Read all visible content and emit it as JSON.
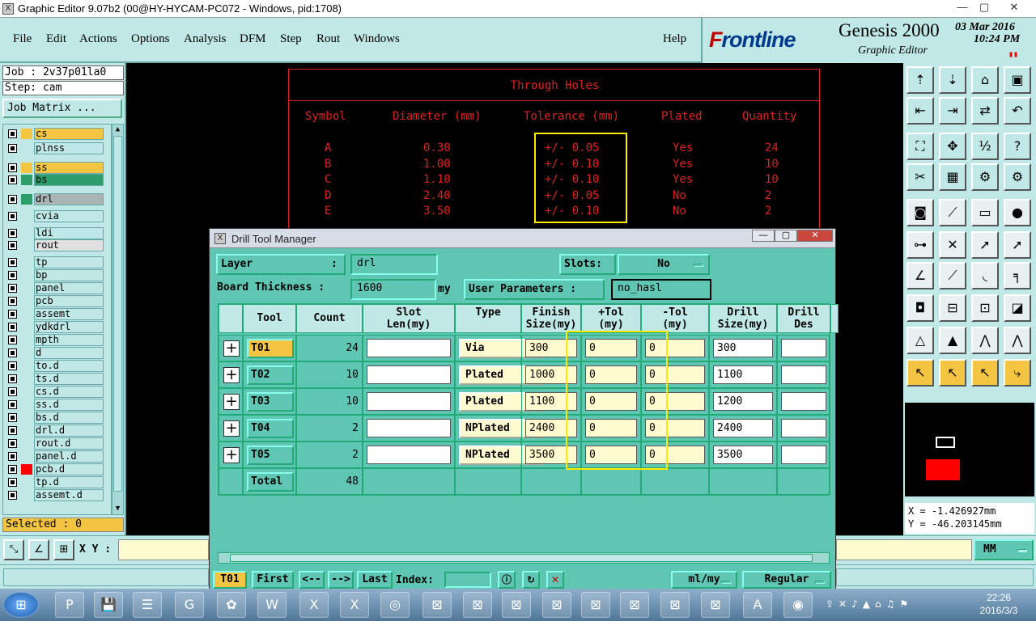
{
  "window": {
    "title": "Graphic Editor 9.07b2 (00@HY-HYCAM-PC072 - Windows, pid:1708)",
    "icon": "X",
    "minimize": "—",
    "maximize": "▢",
    "close": "✕"
  },
  "menu": [
    "File",
    "Edit",
    "Actions",
    "Options",
    "Analysis",
    "DFM",
    "Step",
    "Rout",
    "Windows"
  ],
  "help": "Help",
  "brand": {
    "logo_first": "F",
    "logo_rest": "rontline",
    "product": "Genesis 2000",
    "subtitle": "Graphic Editor",
    "date": "03 Mar 2016",
    "time": "10:24 PM"
  },
  "left": {
    "job": "Job : 2v37p01la0",
    "step": "Step: cam",
    "job_matrix": "Job Matrix ...",
    "selected": "Selected : 0",
    "layers": [
      {
        "name": "cs",
        "color": "#f4c542",
        "bg": "#f4c542"
      },
      {
        "name": "plnss",
        "color": "",
        "bg": ""
      },
      {
        "name": "ss",
        "color": "#f4c542",
        "bg": "#f4c542"
      },
      {
        "name": "bs",
        "color": "#2e9d6b",
        "bg": "#2e9d6b"
      },
      {
        "name": "drl",
        "color": "#2e9d6b",
        "bg": "#a9b4b4"
      },
      {
        "name": "cvia",
        "color": "",
        "bg": ""
      },
      {
        "name": "ldi",
        "color": "",
        "bg": ""
      },
      {
        "name": "rout",
        "color": "",
        "bg": "#e0e0e0"
      },
      {
        "name": "tp",
        "color": "",
        "bg": ""
      },
      {
        "name": "bp",
        "color": "",
        "bg": ""
      },
      {
        "name": "panel",
        "color": "",
        "bg": ""
      },
      {
        "name": "pcb",
        "color": "",
        "bg": ""
      },
      {
        "name": "assemt",
        "color": "",
        "bg": ""
      },
      {
        "name": "ydkdrl",
        "color": "",
        "bg": ""
      },
      {
        "name": "mpth",
        "color": "",
        "bg": ""
      },
      {
        "name": "d",
        "color": "",
        "bg": ""
      },
      {
        "name": "to.d",
        "color": "",
        "bg": ""
      },
      {
        "name": "ts.d",
        "color": "",
        "bg": ""
      },
      {
        "name": "cs.d",
        "color": "",
        "bg": ""
      },
      {
        "name": "ss.d",
        "color": "",
        "bg": ""
      },
      {
        "name": "bs.d",
        "color": "",
        "bg": ""
      },
      {
        "name": "drl.d",
        "color": "",
        "bg": ""
      },
      {
        "name": "rout.d",
        "color": "",
        "bg": ""
      },
      {
        "name": "panel.d",
        "color": "",
        "bg": ""
      },
      {
        "name": "pcb.d",
        "color": "#ff0000",
        "bg": ""
      },
      {
        "name": "tp.d",
        "color": "",
        "bg": ""
      },
      {
        "name": "assemt.d",
        "color": "",
        "bg": ""
      }
    ]
  },
  "through_holes": {
    "title": "Through Holes",
    "headers": [
      "Symbol",
      "Diameter (mm)",
      "Tolerance (mm)",
      "Plated",
      "Quantity"
    ],
    "rows": [
      [
        "A",
        "0.30",
        "+/- 0.05",
        "Yes",
        "24"
      ],
      [
        "B",
        "1.00",
        "+/- 0.10",
        "Yes",
        "10"
      ],
      [
        "C",
        "1.10",
        "+/- 0.10",
        "Yes",
        "10"
      ],
      [
        "D",
        "2.40",
        "+/- 0.05",
        "No",
        "2"
      ],
      [
        "E",
        "3.50",
        "+/- 0.10",
        "No",
        "2"
      ]
    ]
  },
  "dialog": {
    "title": "Drill Tool Manager",
    "layer_label": "Layer",
    "layer_colon": ":",
    "layer_value": "drl",
    "slots_label": "Slots:",
    "slots_value": "No",
    "board_thickness_label": "Board Thickness :",
    "board_thickness_value": "1600",
    "board_thickness_unit": "my",
    "user_params_label": "User Parameters :",
    "user_params_value": "no_hasl",
    "headers": [
      "Tool",
      "Count",
      "Slot\nLen(my)",
      "Type",
      "Finish\nSize(my)",
      "+Tol\n(my)",
      "-Tol\n(my)",
      "Drill\nSize(my)",
      "Drill\nDes"
    ],
    "rows": [
      {
        "tool": "T01",
        "count": "24",
        "slot": "",
        "type": "Via",
        "finish": "300",
        "ptol": "0",
        "mtol": "0",
        "drill": "300",
        "des": ""
      },
      {
        "tool": "T02",
        "count": "10",
        "slot": "",
        "type": "Plated",
        "finish": "1000",
        "ptol": "0",
        "mtol": "0",
        "drill": "1100",
        "des": ""
      },
      {
        "tool": "T03",
        "count": "10",
        "slot": "",
        "type": "Plated",
        "finish": "1100",
        "ptol": "0",
        "mtol": "0",
        "drill": "1200",
        "des": ""
      },
      {
        "tool": "T04",
        "count": "2",
        "slot": "",
        "type": "NPlated",
        "finish": "2400",
        "ptol": "0",
        "mtol": "0",
        "drill": "2400",
        "des": ""
      },
      {
        "tool": "T05",
        "count": "2",
        "slot": "",
        "type": "NPlated",
        "finish": "3500",
        "ptol": "0",
        "mtol": "0",
        "drill": "3500",
        "des": ""
      }
    ],
    "total_label": "Total",
    "total_count": "48",
    "bottom": {
      "current_tool": "T01",
      "first": "First",
      "prev": "<--",
      "next": "-->",
      "last": "Last",
      "index_label": "Index:",
      "units": "ml/my",
      "mode": "Regular"
    }
  },
  "coords": {
    "x": "X = -1.426927mm",
    "y": "Y = -46.203145mm"
  },
  "xy_label": "X Y :",
  "units_sel": "MM",
  "taskbar": {
    "time": "22:26",
    "date": "2016/3/3"
  },
  "colors": {
    "panel": "#bfe8e6",
    "dialog": "#5fc6b4",
    "highlight": "#f4c542",
    "table_red": "#e02020",
    "annotation": "#ffea00"
  }
}
